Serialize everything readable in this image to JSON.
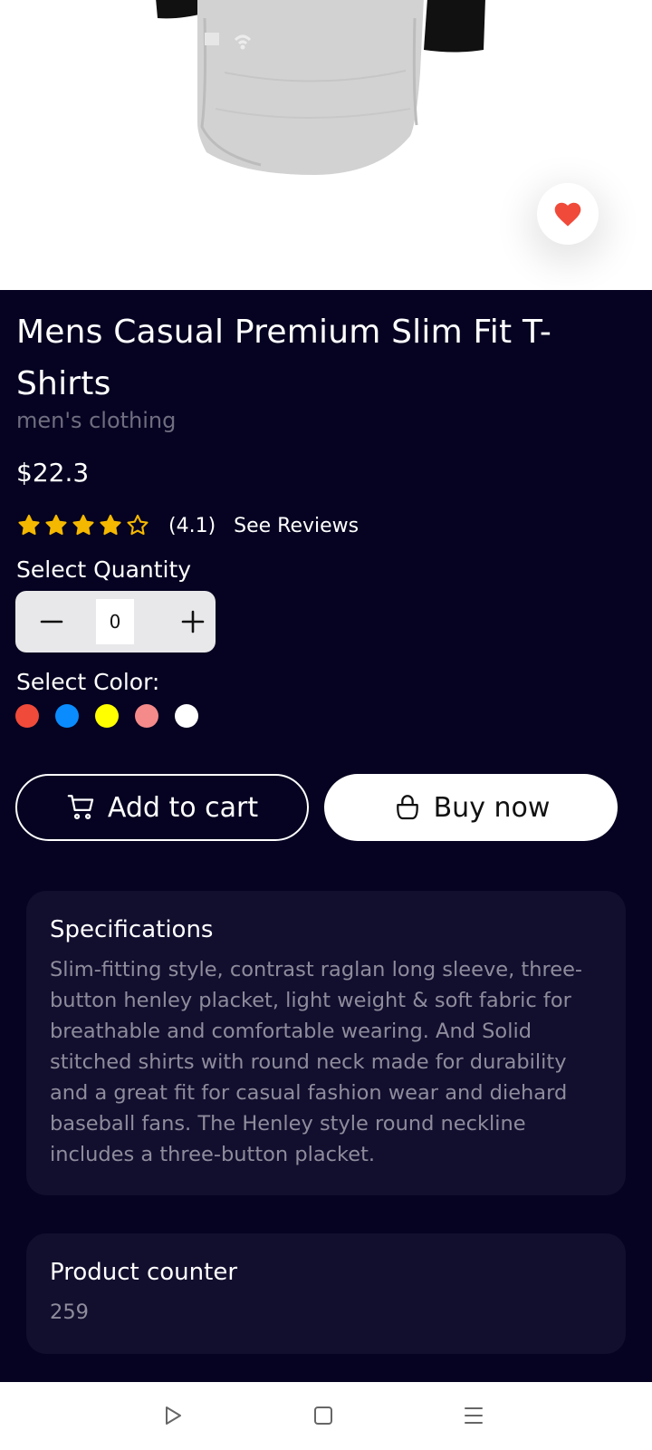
{
  "product": {
    "title": "Mens Casual Premium Slim Fit T-Shirts",
    "category": "men's clothing",
    "price": "$22.3",
    "rating": {
      "value": 4.1,
      "label": "(4.1)",
      "stars_filled": 4,
      "stars_total": 5,
      "star_color": "#f5b800"
    },
    "reviews_link": "See Reviews",
    "image_icon": "tshirt-image",
    "favorite_icon": "heart-icon",
    "favorite_color": "#f04a3a"
  },
  "quantity": {
    "label": "Select Quantity",
    "value": "0",
    "decrement_icon": "minus-icon",
    "increment_icon": "plus-icon"
  },
  "color": {
    "label": "Select Color:",
    "options": [
      "#f04a3a",
      "#0a8cff",
      "#ffff00",
      "#f48a8a",
      "#ffffff"
    ]
  },
  "actions": {
    "add_to_cart": "Add to cart",
    "add_to_cart_icon": "cart-icon",
    "buy_now": "Buy now",
    "buy_now_icon": "shopping-bag-icon"
  },
  "specifications": {
    "title": "Specifications",
    "text": "Slim-fitting style, contrast raglan long sleeve, three-button henley placket, light weight & soft fabric for breathable and comfortable wearing. And Solid stitched shirts with round neck made for durability and a great fit for casual fashion wear and diehard baseball fans. The Henley style round neckline includes a three-button placket."
  },
  "counter": {
    "title": "Product counter",
    "value": "259"
  },
  "navbar": {
    "icons": [
      "back-triangle-icon",
      "home-square-icon",
      "menu-lines-icon"
    ]
  },
  "theme": {
    "background": "#050321",
    "card": "#120e2e",
    "muted_text": "#8e8c9c"
  }
}
